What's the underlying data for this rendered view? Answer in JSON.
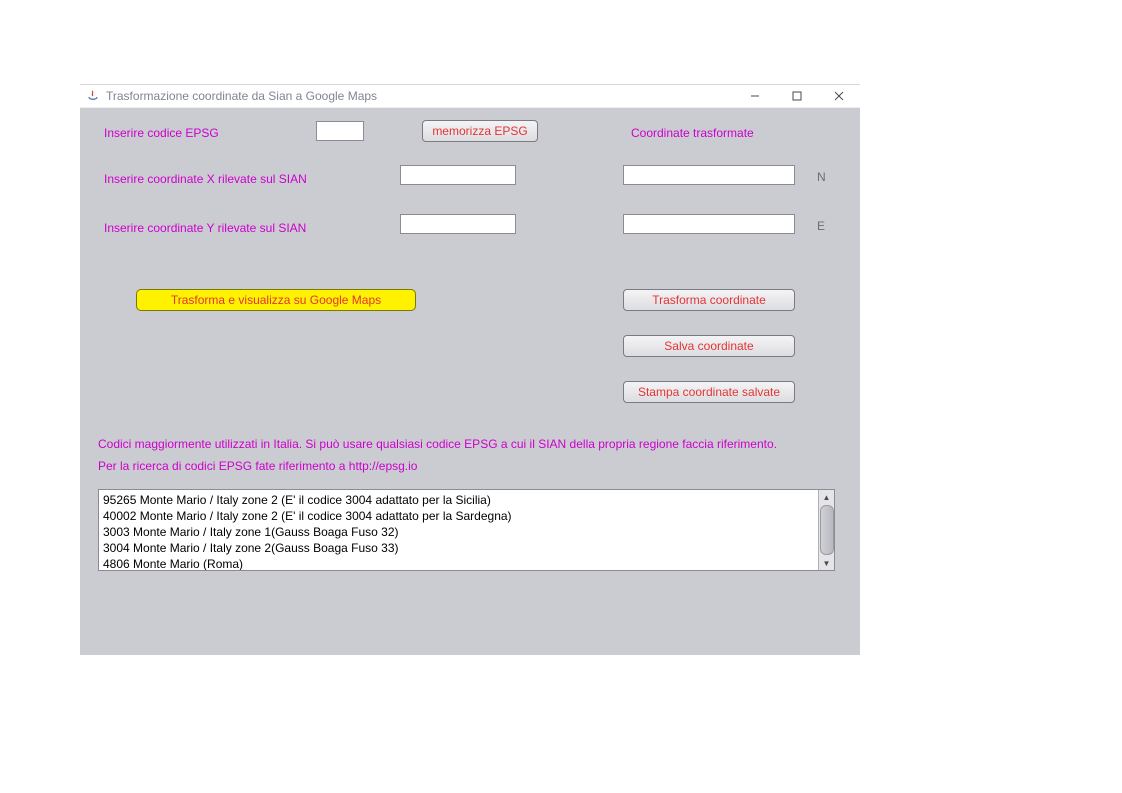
{
  "window": {
    "title": "Trasformazione coordinate da Sian a Google Maps"
  },
  "labels": {
    "epsg": "Inserire codice EPSG",
    "coordX": "Inserire coordinate X rilevate sul SIAN",
    "coordY": "Inserire coordinate Y rilevate sul SIAN",
    "transformed": "Coordinate trasformate",
    "north": "N",
    "east": "E",
    "help1": "Codici maggiormente utilizzati in Italia. Si può usare qualsiasi codice EPSG a cui il SIAN della propria regione faccia riferimento.",
    "help2": "Per la ricerca di codici EPSG fate riferimento a  http://epsg.io"
  },
  "buttons": {
    "memorize": "memorizza EPSG",
    "transformGoogle": "Trasforma e visualizza su Google Maps",
    "transform": "Trasforma coordinate",
    "save": "Salva coordinate",
    "print": "Stampa coordinate salvate"
  },
  "inputs": {
    "epsg": "",
    "x": "",
    "y": "",
    "outN": "",
    "outE": ""
  },
  "list": {
    "items": [
      "95265 Monte Mario / Italy zone 2 (E' il codice 3004 adattato per la Sicilia)",
      "40002 Monte Mario / Italy zone 2 (E' il codice 3004 adattato per la Sardegna)",
      "3003 Monte Mario / Italy zone 1(Gauss Boaga Fuso 32)",
      "3004 Monte Mario / Italy zone 2(Gauss Boaga Fuso 33)",
      "4806 Monte Mario (Roma)"
    ]
  }
}
